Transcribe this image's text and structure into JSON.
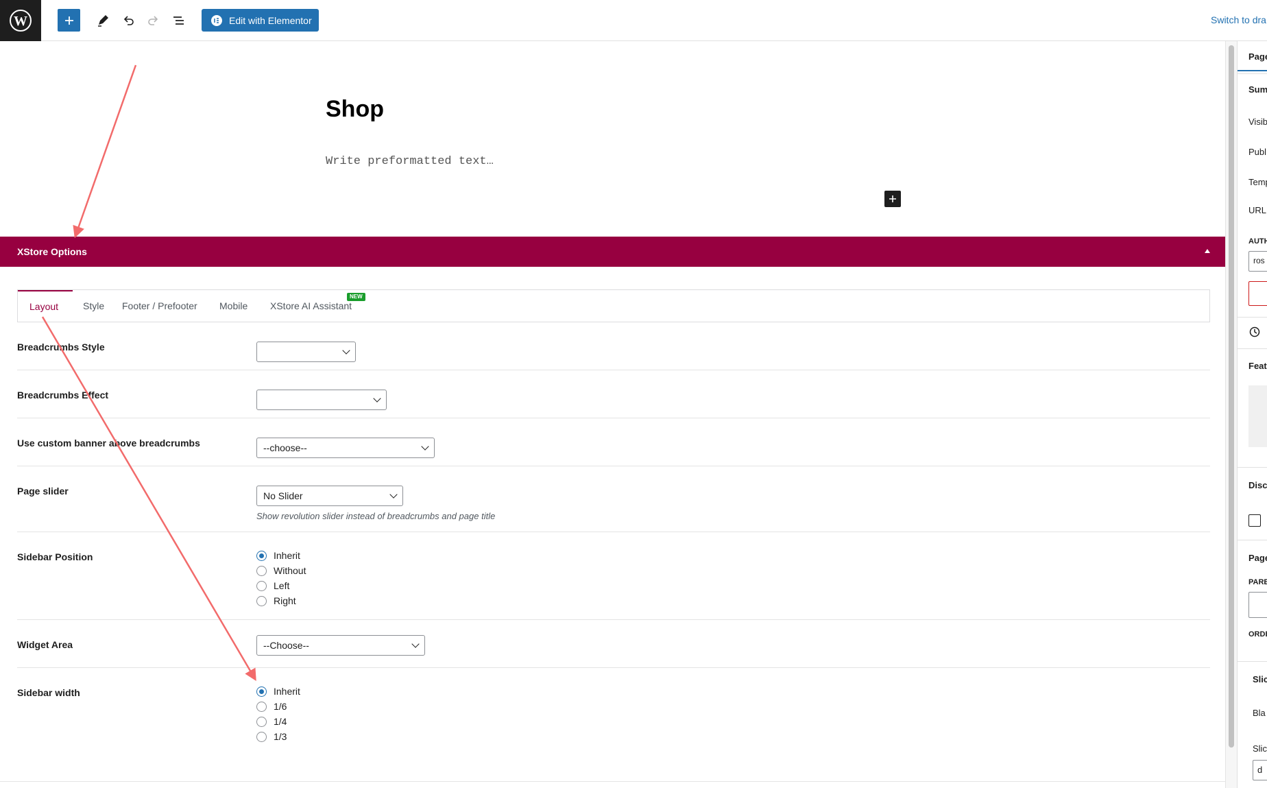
{
  "toolbar": {
    "edit_with_elementor": "Edit with Elementor",
    "switch_to_draft": "Switch to dra"
  },
  "editor": {
    "title": "Shop",
    "preformatted_placeholder": "Write preformatted text…"
  },
  "xstore": {
    "header": "XStore Options",
    "tabs": [
      "Layout",
      "Style",
      "Footer / Prefooter",
      "Mobile",
      "XStore AI Assistant"
    ],
    "new_badge": "NEW",
    "options": {
      "breadcrumbs_style": {
        "label": "Breadcrumbs Style",
        "value": ""
      },
      "breadcrumbs_effect": {
        "label": "Breadcrumbs Effect",
        "value": ""
      },
      "custom_banner": {
        "label": "Use custom banner above breadcrumbs",
        "value": "--choose--"
      },
      "page_slider": {
        "label": "Page slider",
        "value": "No Slider",
        "description": "Show revolution slider instead of breadcrumbs and page title"
      },
      "sidebar_position": {
        "label": "Sidebar Position",
        "choices": [
          "Inherit",
          "Without",
          "Left",
          "Right"
        ],
        "selected": "Inherit"
      },
      "widget_area": {
        "label": "Widget Area",
        "value": "--Choose--"
      },
      "sidebar_width": {
        "label": "Sidebar width",
        "choices": [
          "Inherit",
          "1/6",
          "1/4",
          "1/3"
        ],
        "selected": "Inherit"
      }
    }
  },
  "sidebar": {
    "tab": "Page",
    "items": [
      "Sum",
      "Visib",
      "Publ",
      "Temp",
      "URL"
    ],
    "author_label": "AUTH",
    "author_value": "ros",
    "featured": "Feat",
    "discussion": "Disc",
    "page_attributes": "Page",
    "parent_label": "PARE",
    "order_label": "ORDE",
    "slider": "Slic",
    "blank": "Bla",
    "slider2": "Slic",
    "slider_value": "d"
  },
  "colors": {
    "accent": "#970040",
    "primary": "#2271b1",
    "annotation_arrow": "#f26b6b"
  }
}
